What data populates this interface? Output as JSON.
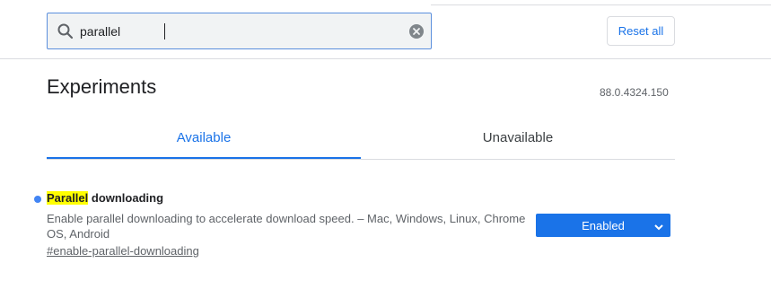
{
  "search": {
    "value": "parallel",
    "clear_icon": "clear-icon",
    "search_icon": "search-icon"
  },
  "toolbar": {
    "reset_label": "Reset all"
  },
  "page": {
    "title": "Experiments",
    "version": "88.0.4324.150"
  },
  "tabs": [
    {
      "label": "Available",
      "selected": true
    },
    {
      "label": "Unavailable",
      "selected": false
    }
  ],
  "experiment": {
    "title_highlight": "Parallel",
    "title_rest": " downloading",
    "description": "Enable parallel downloading to accelerate download speed. – Mac, Windows, Linux, Chrome OS, Android",
    "link": "#enable-parallel-downloading",
    "state": "Enabled"
  },
  "colors": {
    "accent": "#1a73e8",
    "highlight": "#ffff00",
    "dot": "#4285f4"
  }
}
